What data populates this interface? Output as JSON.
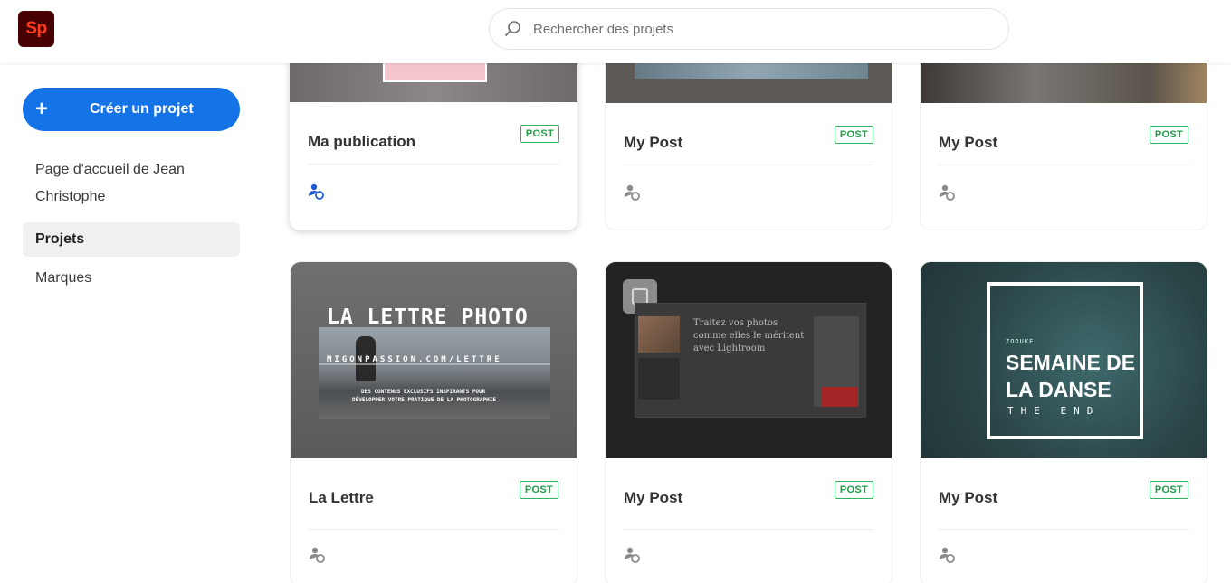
{
  "app": {
    "logo_text": "Sp"
  },
  "search": {
    "placeholder": "Rechercher des projets"
  },
  "sidebar": {
    "create_label": "Créer un projet",
    "items": [
      {
        "label": "Page d'accueil de Jean Christophe",
        "active": false
      },
      {
        "label": "Projets",
        "active": true
      },
      {
        "label": "Marques",
        "active": false
      }
    ]
  },
  "cards": [
    {
      "title": "Ma publication",
      "badge": "POST"
    },
    {
      "title": "My Post",
      "badge": "POST"
    },
    {
      "title": "My Post",
      "badge": "POST"
    },
    {
      "title": "La Lettre",
      "badge": "POST",
      "poster": {
        "title": "LA LETTRE PHOTO",
        "subtitle": "MIGONPASSION.COM/LETTRE",
        "line1": "DES CONTENUS EXCLUSIFS INSPIRANTS POUR",
        "line2": "DÉVELOPPER VOTRE PRATIQUE DE LA PHOTOGRAPHIE"
      }
    },
    {
      "title": "My Post",
      "badge": "POST",
      "poster": {
        "line1": "Traitez vos photos",
        "line2": "comme elles le méritent",
        "line3": "avec Lightroom"
      }
    },
    {
      "title": "My Post",
      "badge": "POST",
      "poster": {
        "small": "ZOOUKE",
        "title1": "SEMAINE DE",
        "title2": "LA DANSE",
        "sub": "THE END"
      }
    }
  ],
  "colors": {
    "accent": "#1473e6",
    "badge": "#2fb55d"
  }
}
